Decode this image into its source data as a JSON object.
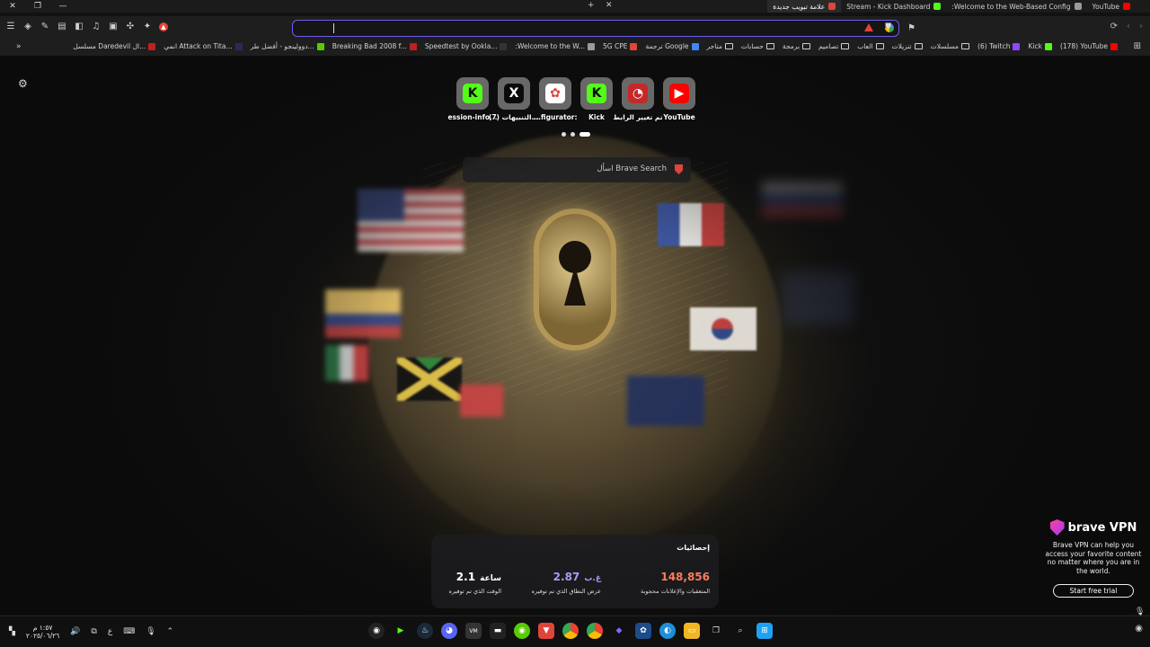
{
  "window": {
    "close": "✕",
    "restore": "❐",
    "minimize": "—"
  },
  "tabs": [
    {
      "label": "YouTube",
      "color": "#ff0000",
      "active": false
    },
    {
      "label": ":Welcome to the Web-Based Config",
      "color": "#9a9a9a",
      "active": false
    },
    {
      "label": "Stream - Kick Dashboard",
      "color": "#53fc18",
      "active": false
    },
    {
      "label": "علامة تبويب جديدة",
      "color": "#e0453b",
      "active": true
    }
  ],
  "tab_new": "+",
  "tab_close": "✕",
  "address": {
    "value": ""
  },
  "nav": {
    "reload": "⟳",
    "back": "‹",
    "forward": "›"
  },
  "bookmarks": [
    {
      "label": "(178) YouTube",
      "color": "#ff0000",
      "type": "site"
    },
    {
      "label": "Kick",
      "color": "#53fc18",
      "type": "site"
    },
    {
      "label": "(6) Twitch",
      "color": "#9146ff",
      "type": "site"
    },
    {
      "label": "مسلسلات",
      "type": "folder"
    },
    {
      "label": "تنزيلات",
      "type": "folder"
    },
    {
      "label": "العاب",
      "type": "folder"
    },
    {
      "label": "تصاميم",
      "type": "folder"
    },
    {
      "label": "برمجة",
      "type": "folder"
    },
    {
      "label": "حسابات",
      "type": "folder"
    },
    {
      "label": "متاجر",
      "type": "folder"
    },
    {
      "label": "ترجمة Google",
      "color": "#4285f4",
      "type": "site"
    },
    {
      "label": "5G CPE",
      "color": "#e0453b",
      "type": "site"
    },
    {
      "label": ":Welcome to the W...",
      "color": "#9a9a9a",
      "type": "site"
    },
    {
      "label": "Speedtest by Ookla...",
      "color": "#333333",
      "type": "site"
    },
    {
      "label": "Breaking Bad 2008 f...",
      "color": "#c02020",
      "type": "site"
    },
    {
      "label": "دوولينجو - أفضل طر...",
      "color": "#58cc02",
      "type": "site"
    },
    {
      "label": "انمي Attack on Tita...",
      "color": "#2a2a5a",
      "type": "site"
    },
    {
      "label": "مسلسل Daredevil ال...",
      "color": "#c02020",
      "type": "site"
    }
  ],
  "bookmark_more": "»",
  "top_sites": [
    {
      "label": "YouTube",
      "glyph": "▶",
      "bg": "#ff0000",
      "fg": "#ffffff"
    },
    {
      "label": "تم تغيير الرابط",
      "glyph": "◔",
      "bg": "#c62828",
      "fg": "#ffffff"
    },
    {
      "label": "Kick",
      "glyph": "K",
      "bg": "#53fc18",
      "fg": "#0b0b0b"
    },
    {
      "label": "...figurator:",
      "glyph": "✿",
      "bg": "#ffffff",
      "fg": "#e0453b"
    },
    {
      "label": "(7) التنبيهات...",
      "glyph": "X",
      "bg": "#0b0b0b",
      "fg": "#ffffff"
    },
    {
      "label": "ession-info...",
      "glyph": "K",
      "bg": "#53fc18",
      "fg": "#0b0b0b"
    }
  ],
  "search": {
    "placeholder": "اسأل Brave Search"
  },
  "stats": {
    "title": "إحصائيات",
    "items": [
      {
        "value": "148,856",
        "unit": "",
        "caption": "المتعقبات والإعلانات محجوبة"
      },
      {
        "value": "2.87",
        "unit": "غ.ب",
        "caption": "عرض النطاق الذي تم توفيره"
      },
      {
        "value": "2.1",
        "unit": "ساعة",
        "caption": "الوقت الذي تم توفيره"
      }
    ]
  },
  "vpn": {
    "brand": "brave VPN",
    "description": "Brave VPN can help you access your favorite content no matter where you are in the world.",
    "cta": "Start free trial"
  },
  "taskbar": {
    "clock_time": "١:٥٧ م",
    "clock_date": "٢٠٢٥/٠٦/٢٦",
    "lang": "ع"
  },
  "colors": {
    "accent": "#6d5cf0",
    "brave": "#e0453b"
  }
}
